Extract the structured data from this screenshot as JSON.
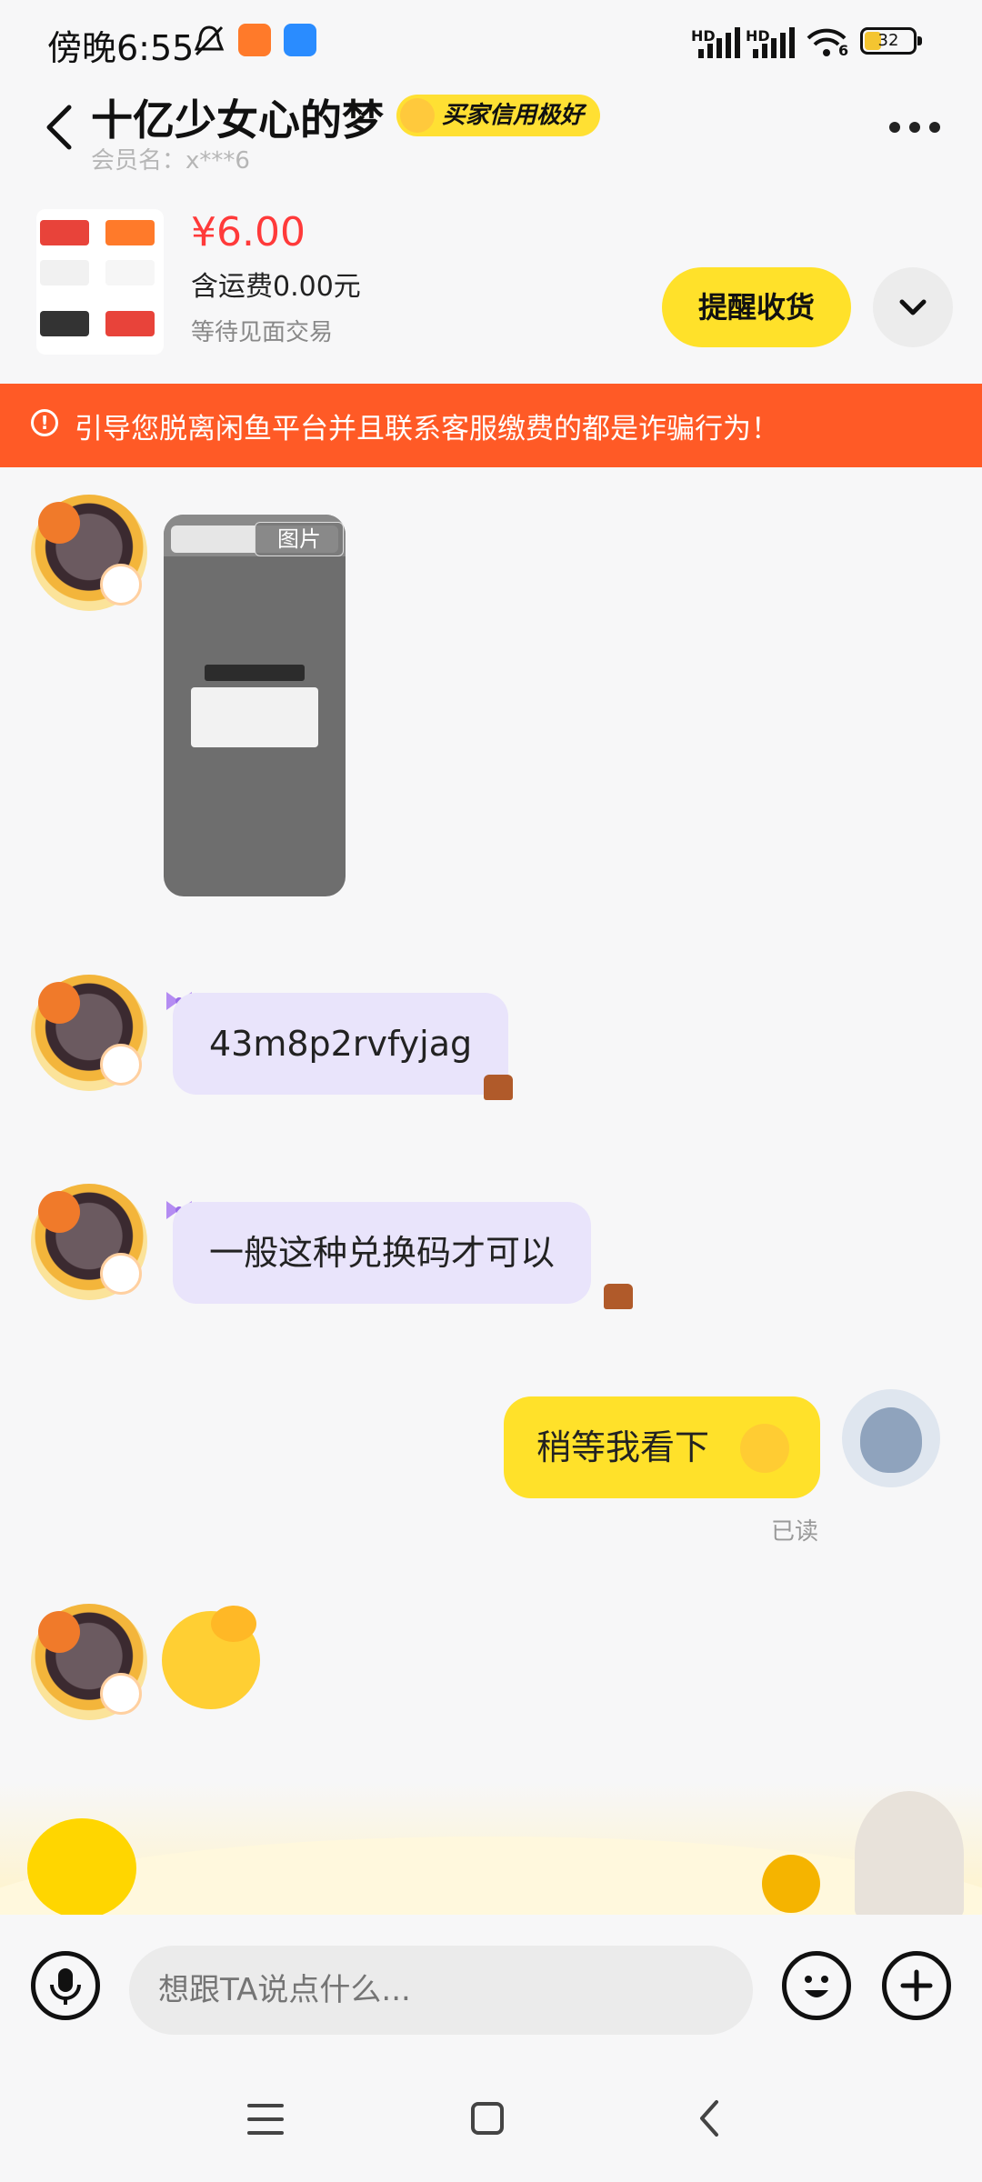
{
  "status_bar": {
    "time": "傍晚6:55",
    "hd1": "HD",
    "hd2": "HD",
    "wifi_badge": "6",
    "battery": "32"
  },
  "header": {
    "title": "十亿少女心的梦",
    "credit_badge": "买家信用极好",
    "member_label": "会员名：x***6"
  },
  "order": {
    "price": "¥6.00",
    "shipping": "含运费0.00元",
    "status": "等待见面交易",
    "remind_button": "提醒收货"
  },
  "warning": {
    "icon": "!",
    "text": "引导您脱离闲鱼平台并且联系客服缴费的都是诈骗行为！"
  },
  "chat": {
    "image_label": "图片",
    "msg_code": "43m8p2rvfyjag",
    "msg_text": "一般这种兑换码才可以",
    "my_msg": "稍等我看下",
    "read_status": "已读"
  },
  "input": {
    "placeholder": "想跟TA说点什么..."
  },
  "colors": {
    "accent_yellow": "#ffe12a",
    "warning_orange": "#ff5a26",
    "price_red": "#ff3a3a",
    "bubble_purple": "#e9e4fb"
  },
  "icons": [
    "back-icon",
    "more-icon",
    "chevron-down-icon",
    "warning-icon",
    "microphone-icon",
    "emoji-icon",
    "plus-icon",
    "menu-icon",
    "home-icon",
    "nav-back-icon"
  ]
}
